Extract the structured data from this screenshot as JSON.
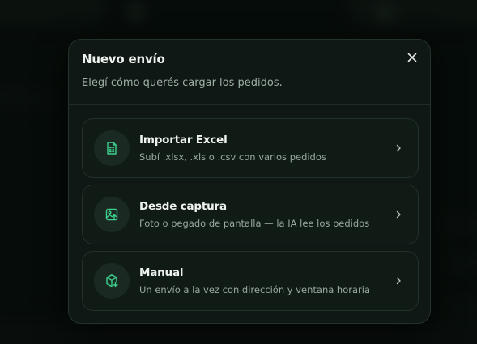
{
  "modal": {
    "title": "Nuevo envío",
    "subtitle": "Elegí cómo querés cargar los pedidos.",
    "close_icon": "close-icon"
  },
  "options": [
    {
      "title": "Importar Excel",
      "description": "Subí .xlsx, .xls o .csv con varios pedidos",
      "icon": "spreadsheet-file-icon"
    },
    {
      "title": "Desde captura",
      "description": "Foto o pegado de pantalla — la IA lee los pedidos",
      "icon": "image-upload-icon"
    },
    {
      "title": "Manual",
      "description": "Un envío a la vez con dirección y ventana horaria",
      "icon": "box-add-icon"
    }
  ],
  "colors": {
    "accent": "#3ecf8e",
    "modal_background": "#0f1814",
    "card_background": "#111b16",
    "text_primary": "#eef3ef",
    "text_secondary": "#98a79f"
  }
}
